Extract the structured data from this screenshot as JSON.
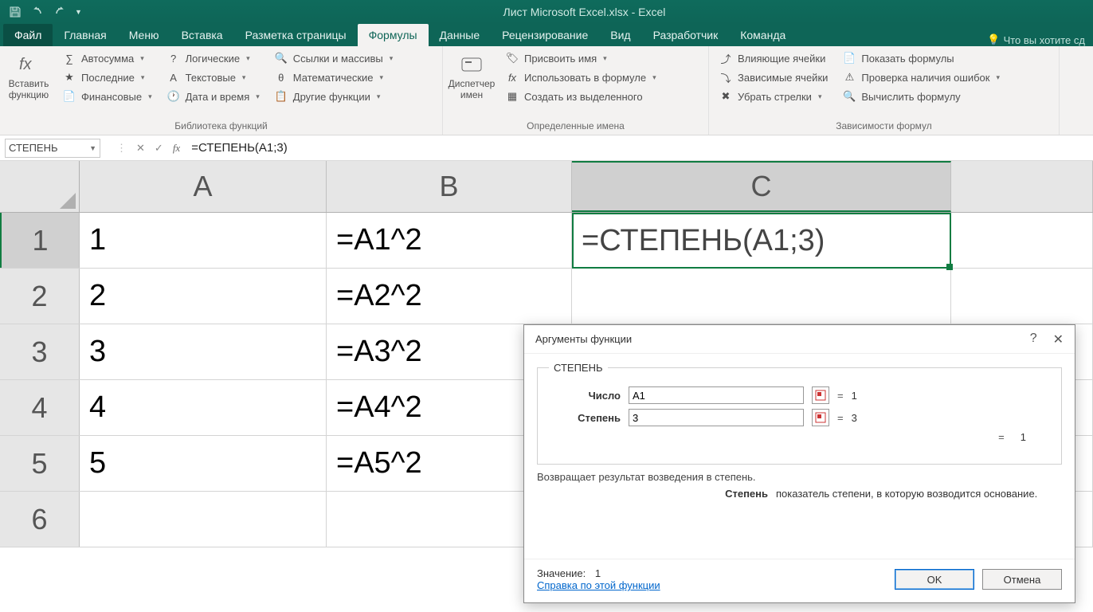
{
  "title": "Лист Microsoft Excel.xlsx - Excel",
  "tabs": {
    "file": "Файл",
    "home": "Главная",
    "menu": "Меню",
    "insert": "Вставка",
    "layout": "Разметка страницы",
    "formulas": "Формулы",
    "data": "Данные",
    "review": "Рецензирование",
    "view": "Вид",
    "developer": "Разработчик",
    "team": "Команда",
    "tell": "Что вы хотите сд"
  },
  "ribbon": {
    "insert_fn": "Вставить функцию",
    "autosum": "Автосумма",
    "recent": "Последние",
    "financial": "Финансовые",
    "logical": "Логические",
    "text": "Текстовые",
    "datetime": "Дата и время",
    "lookup": "Ссылки и массивы",
    "math": "Математические",
    "more": "Другие функции",
    "lib_label": "Библиотека функций",
    "name_mgr": "Диспетчер имен",
    "define": "Присвоить имя",
    "use_in": "Использовать в формуле",
    "create_from": "Создать из выделенного",
    "names_label": "Определенные имена",
    "trace_prec": "Влияющие ячейки",
    "trace_dep": "Зависимые ячейки",
    "remove_arr": "Убрать стрелки",
    "show_f": "Показать формулы",
    "err_check": "Проверка наличия ошибок",
    "eval_f": "Вычислить формулу",
    "audit_label": "Зависимости формул"
  },
  "fbar": {
    "name": "СТЕПЕНЬ",
    "formula": "=СТЕПЕНЬ(A1;3)"
  },
  "columns": [
    "A",
    "B",
    "C"
  ],
  "rows": [
    {
      "n": "1",
      "A": "1",
      "B": "=A1^2",
      "C": "=СТЕПЕНЬ(A1;3)"
    },
    {
      "n": "2",
      "A": "2",
      "B": "=A2^2",
      "C": ""
    },
    {
      "n": "3",
      "A": "3",
      "B": "=A3^2",
      "C": ""
    },
    {
      "n": "4",
      "A": "4",
      "B": "=A4^2",
      "C": ""
    },
    {
      "n": "5",
      "A": "5",
      "B": "=A5^2",
      "C": ""
    },
    {
      "n": "6",
      "A": "",
      "B": "",
      "C": ""
    }
  ],
  "dialog": {
    "title": "Аргументы функции",
    "fn": "СТЕПЕНЬ",
    "arg1_label": "Число",
    "arg1_value": "A1",
    "arg1_result": "1",
    "arg2_label": "Степень",
    "arg2_value": "3",
    "arg2_result": "3",
    "result_eq": "1",
    "desc": "Возвращает результат возведения в степень.",
    "arg_name": "Степень",
    "arg_desc": "показатель степени, в которую возводится основание.",
    "value_label": "Значение:",
    "value": "1",
    "help": "Справка по этой функции",
    "ok": "OK",
    "cancel": "Отмена"
  }
}
